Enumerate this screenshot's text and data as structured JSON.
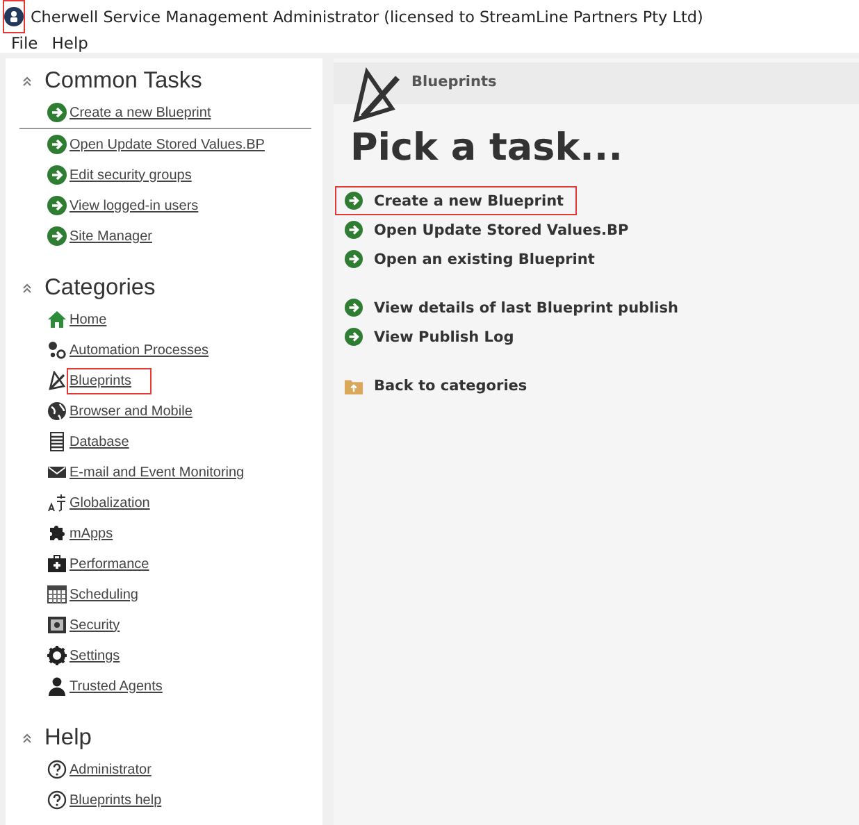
{
  "window": {
    "title": "Cherwell Service Management Administrator (licensed to StreamLine Partners Pty Ltd)",
    "icon_highlighted": true
  },
  "menu": [
    "File",
    "Help"
  ],
  "sidebar": {
    "sections": [
      {
        "title": "Common Tasks",
        "expanded": true,
        "items": [
          {
            "label": "Create a new Blueprint",
            "highlighted": false
          },
          {
            "label": "Open Update Stored Values.BP",
            "highlighted": false
          },
          {
            "label": "Edit security groups",
            "highlighted": false
          },
          {
            "label": "View logged-in users",
            "highlighted": false
          },
          {
            "label": "Site Manager",
            "highlighted": false
          }
        ]
      },
      {
        "title": "Categories",
        "expanded": true,
        "items": [
          {
            "label": "Home",
            "highlighted": false
          },
          {
            "label": "Automation Processes",
            "highlighted": false
          },
          {
            "label": "Blueprints",
            "highlighted": true
          },
          {
            "label": "Browser and Mobile",
            "highlighted": false
          },
          {
            "label": "Database",
            "highlighted": false
          },
          {
            "label": "E-mail and Event Monitoring",
            "highlighted": false
          },
          {
            "label": "Globalization",
            "highlighted": false
          },
          {
            "label": "mApps",
            "highlighted": false
          },
          {
            "label": "Performance",
            "highlighted": false
          },
          {
            "label": "Scheduling",
            "highlighted": false
          },
          {
            "label": "Security",
            "highlighted": false
          },
          {
            "label": "Settings",
            "highlighted": false
          },
          {
            "label": "Trusted Agents",
            "highlighted": false
          }
        ]
      },
      {
        "title": "Help",
        "expanded": true,
        "items": [
          {
            "label": "Administrator",
            "highlighted": false
          },
          {
            "label": "Blueprints help",
            "highlighted": false
          }
        ]
      }
    ]
  },
  "main": {
    "header": "Blueprints",
    "heading": "Pick a task...",
    "groups": [
      [
        {
          "label": "Create a new Blueprint",
          "kind": "task",
          "highlighted": true
        },
        {
          "label": "Open Update Stored Values.BP",
          "kind": "task",
          "highlighted": false
        },
        {
          "label": "Open an existing Blueprint",
          "kind": "task",
          "highlighted": false
        }
      ],
      [
        {
          "label": "View details of last Blueprint publish",
          "kind": "task",
          "highlighted": false
        },
        {
          "label": "View Publish Log",
          "kind": "task",
          "highlighted": false
        }
      ],
      [
        {
          "label": "Back to categories",
          "kind": "back",
          "highlighted": false
        }
      ]
    ]
  }
}
